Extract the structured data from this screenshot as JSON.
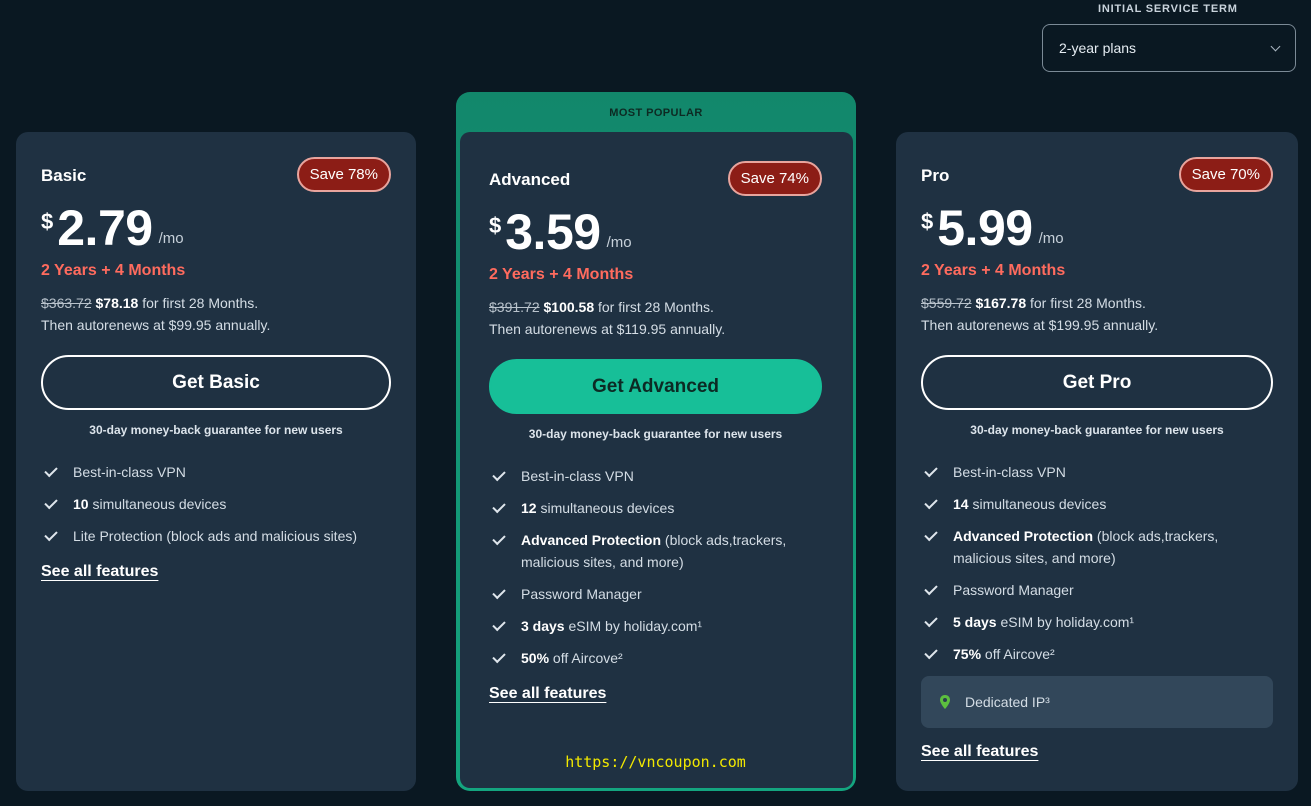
{
  "term_selector": {
    "label": "INITIAL SERVICE TERM",
    "value": "2-year plans"
  },
  "popular_label": "MOST POPULAR",
  "plans": [
    {
      "name": "Basic",
      "save": "Save 78%",
      "currency": "$",
      "price": "2.79",
      "per": "/mo",
      "term": "2 Years + 4 Months",
      "original": "$363.72",
      "discounted": "$78.18",
      "first_period": " for first 28 Months.",
      "renew": "Then autorenews at $99.95 annually.",
      "cta": "Get Basic",
      "guarantee": "30-day money-back guarantee for new users",
      "features": [
        {
          "bold": "",
          "text": "Best-in-class VPN"
        },
        {
          "bold": "10",
          "text": " simultaneous devices"
        },
        {
          "bold": "",
          "text": "Lite Protection (block ads and malicious sites)"
        }
      ],
      "see_all": "See all features"
    },
    {
      "name": "Advanced",
      "save": "Save 74%",
      "currency": "$",
      "price": "3.59",
      "per": "/mo",
      "term": "2 Years + 4 Months",
      "original": "$391.72",
      "discounted": "$100.58",
      "first_period": " for first 28 Months.",
      "renew": "Then autorenews at $119.95 annually.",
      "cta": "Get Advanced",
      "guarantee": "30-day money-back guarantee for new users",
      "features": [
        {
          "bold": "",
          "text": "Best-in-class VPN"
        },
        {
          "bold": "12",
          "text": " simultaneous devices"
        },
        {
          "bold": "Advanced Protection",
          "text": " (block ads,trackers, malicious sites, and more)"
        },
        {
          "bold": "",
          "text": "Password Manager"
        },
        {
          "bold": "3 days",
          "text": " eSIM by holiday.com¹"
        },
        {
          "bold": "50%",
          "text": " off Aircove²"
        }
      ],
      "see_all": "See all features"
    },
    {
      "name": "Pro",
      "save": "Save 70%",
      "currency": "$",
      "price": "5.99",
      "per": "/mo",
      "term": "2 Years + 4 Months",
      "original": "$559.72",
      "discounted": "$167.78",
      "first_period": " for first 28 Months.",
      "renew": "Then autorenews at $199.95 annually.",
      "cta": "Get Pro",
      "guarantee": "30-day money-back guarantee for new users",
      "features": [
        {
          "bold": "",
          "text": "Best-in-class VPN"
        },
        {
          "bold": "14",
          "text": " simultaneous devices"
        },
        {
          "bold": "Advanced Protection",
          "text": " (block ads,trackers, malicious sites, and more)"
        },
        {
          "bold": "",
          "text": "Password Manager"
        },
        {
          "bold": "5 days",
          "text": " eSIM by holiday.com¹"
        },
        {
          "bold": "75%",
          "text": " off Aircove²"
        }
      ],
      "extra": {
        "icon": "location-pin-icon",
        "text": "Dedicated IP³"
      },
      "see_all": "See all features"
    }
  ],
  "watermark": "https://vncoupon.com",
  "colors": {
    "accent": "#17bf98",
    "badge": "#8c1d16",
    "term": "#ff6b5e",
    "background": "#0a1822",
    "card": "#1f3142"
  }
}
